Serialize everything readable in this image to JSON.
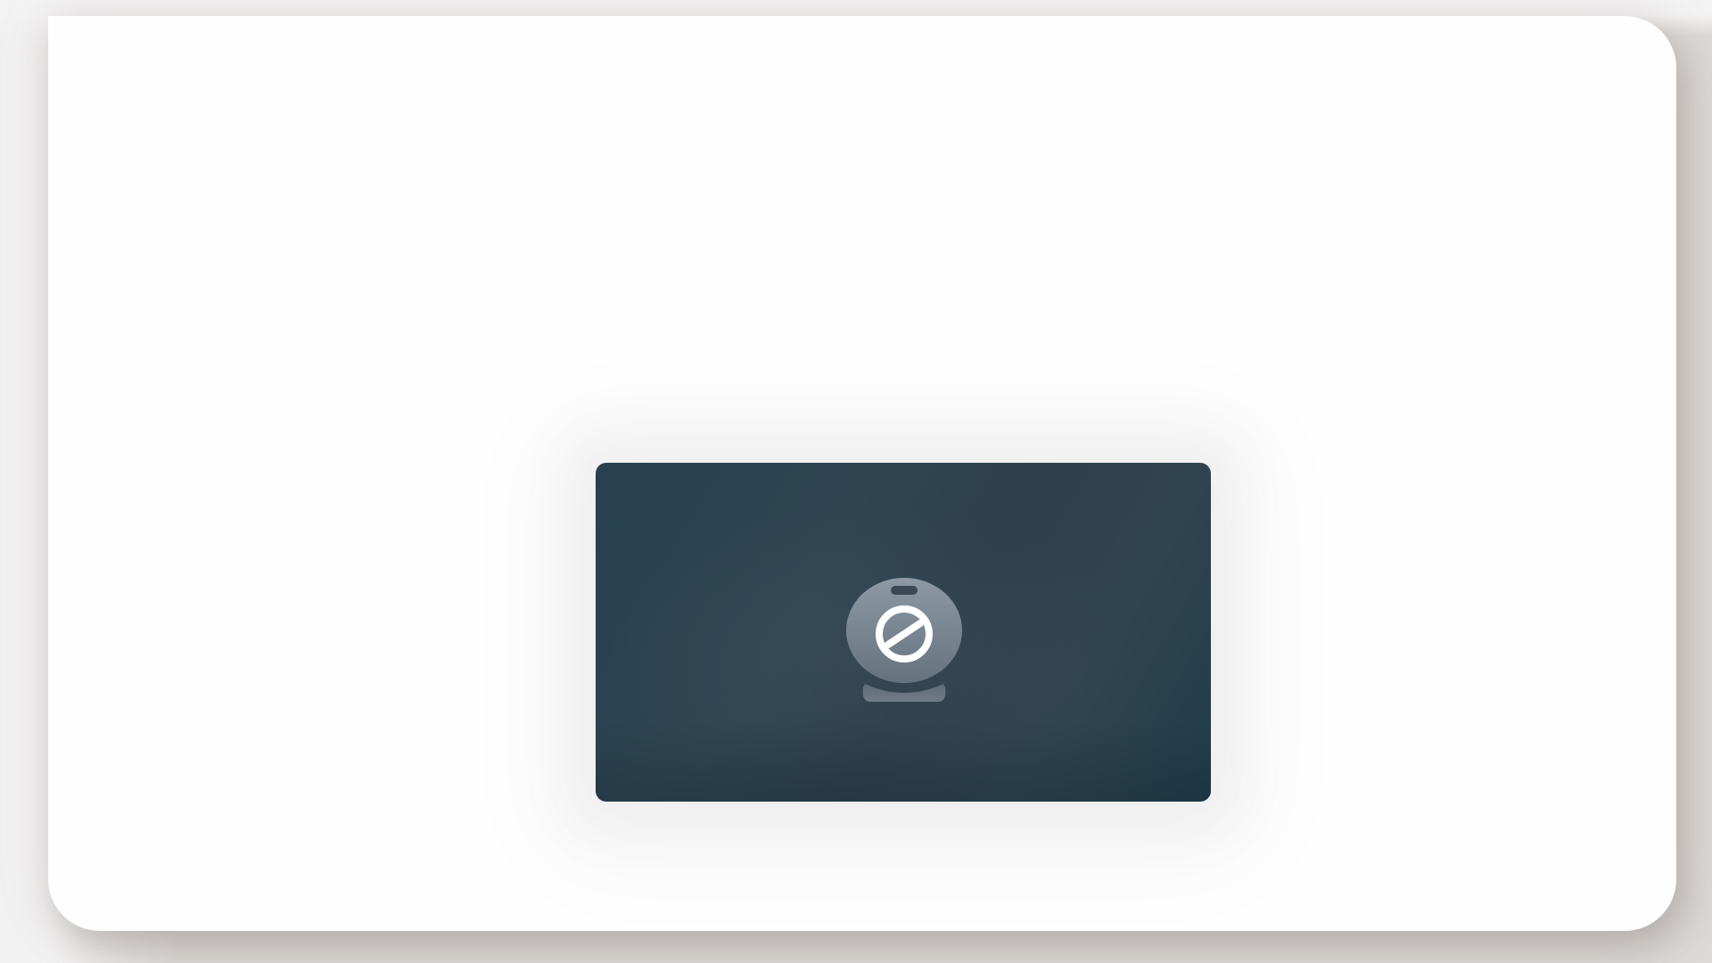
{
  "window": {
    "name": "video-window"
  },
  "video_preview": {
    "state": "camera-disabled",
    "icon": "camera-off-icon",
    "colors": {
      "card_background": "#2e4350",
      "icon_body": "#7c8a97",
      "icon_symbol": "#ffffff"
    }
  }
}
